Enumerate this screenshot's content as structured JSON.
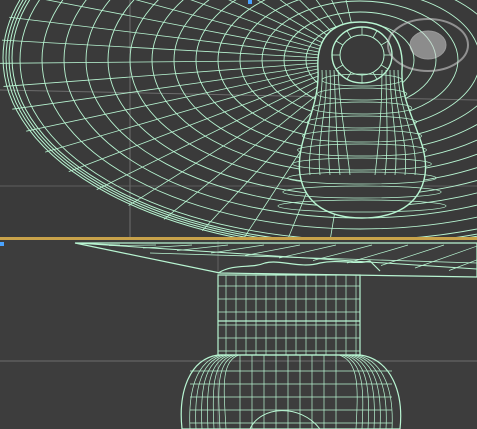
{
  "colors": {
    "wire": "#b8f5d2",
    "viewport_bg": "#3a3a3a",
    "grid": "#6d6d6d",
    "active_border": "#c8a24a",
    "marker": "#4aa3ff"
  },
  "viewports": [
    {
      "name": "top-viewport",
      "active": false
    },
    {
      "name": "bottom-viewport",
      "active": true
    }
  ],
  "icons": [
    "viewcube-icon"
  ]
}
